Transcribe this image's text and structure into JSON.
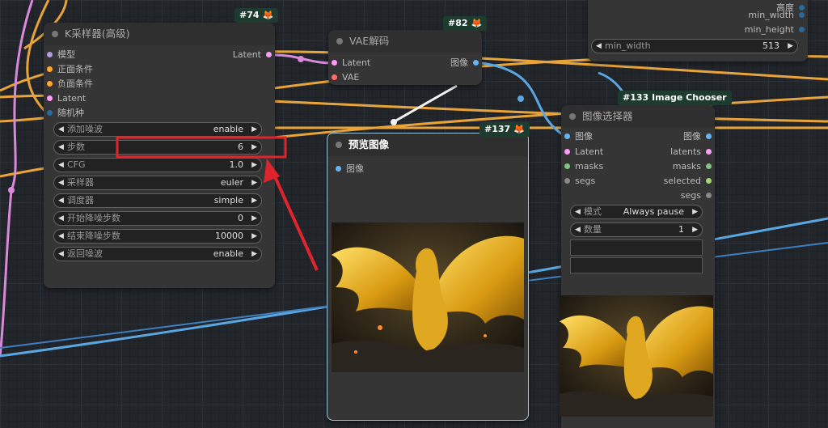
{
  "nodes": {
    "ksampler": {
      "badge": "#74",
      "title": "K采样器(高级)",
      "inputs": [
        "模型",
        "正面条件",
        "负面条件",
        "Latent",
        "随机种"
      ],
      "output": "Latent",
      "widgets": [
        {
          "label": "添加噪波",
          "value": "enable"
        },
        {
          "label": "步数",
          "value": "6"
        },
        {
          "label": "CFG",
          "value": "1.0"
        },
        {
          "label": "采样器",
          "value": "euler"
        },
        {
          "label": "调度器",
          "value": "simple"
        },
        {
          "label": "开始降噪步数",
          "value": "0"
        },
        {
          "label": "结束降噪步数",
          "value": "10000"
        },
        {
          "label": "返回噪波",
          "value": "enable"
        }
      ]
    },
    "vae": {
      "badge": "#82",
      "title": "VAE解码",
      "inputs": [
        "Latent",
        "VAE"
      ],
      "output": "图像"
    },
    "preview": {
      "badge": "#137",
      "title": "预览图像",
      "input": "图像"
    },
    "chooser": {
      "badge": "#133 Image Chooser",
      "title": "图像选择器",
      "inputs": [
        "图像",
        "Latent",
        "masks",
        "segs"
      ],
      "outputs": [
        "图像",
        "latents",
        "masks",
        "selected",
        "segs"
      ],
      "widgets": [
        {
          "label": "模式",
          "value": "Always pause"
        },
        {
          "label": "数量",
          "value": "1"
        }
      ]
    },
    "topright": {
      "outputs": [
        "高度",
        "min_width",
        "min_height"
      ],
      "widget": {
        "label": "min_width",
        "value": "513"
      }
    }
  },
  "colors": {
    "highlight": "#e0242c",
    "wire_orange": "#e8a43a",
    "wire_pink": "#d989d9",
    "wire_blue": "#5aa6e0",
    "wire_white": "#f2f2f2",
    "slot_model": "#b39ddb",
    "slot_cond": "#ffa931",
    "slot_latent": "#ff9cf9",
    "slot_int": "#29699c",
    "slot_image": "#64b5f6",
    "slot_vae": "#ff6e6e",
    "slot_mask": "#81c784",
    "slot_segs": "#888888",
    "slot_selected": "#a5d66f",
    "badge_bg": "#1e3b2f"
  },
  "icons": [
    "fox-icon",
    "arrow-left-icon",
    "arrow-right-icon"
  ]
}
